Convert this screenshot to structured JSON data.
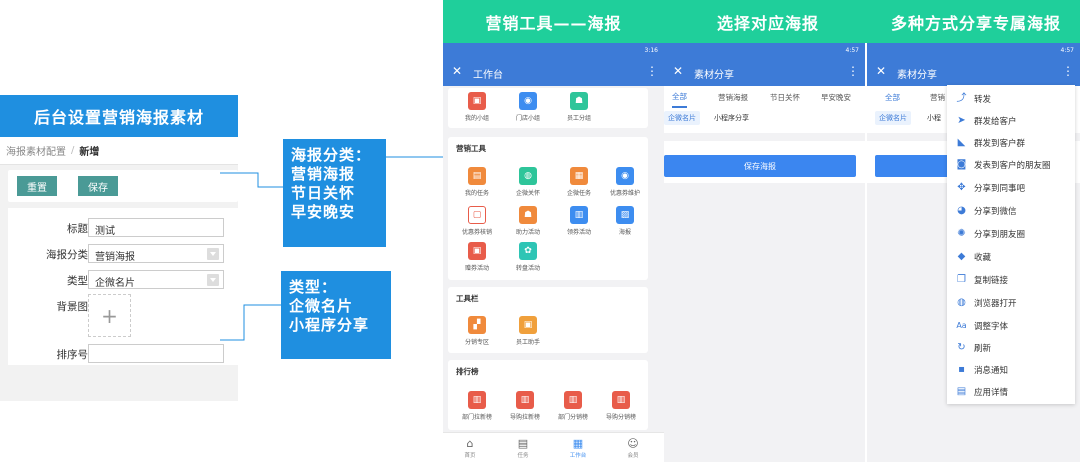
{
  "admin": {
    "title": "后台设置营销海报素材",
    "breadcrumb": {
      "parent": "海报素材配置",
      "separator": "/",
      "current": "新增"
    },
    "buttons": {
      "reset": "重置",
      "save": "保存"
    },
    "form": {
      "title_label": "标题",
      "title_value": "测试",
      "category_label": "海报分类",
      "category_value": "营销海报",
      "type_label": "类型",
      "type_value": "企微名片",
      "bg_label": "背景图",
      "upload_glyph": "+",
      "order_label": "排序号",
      "order_value": ""
    }
  },
  "callouts": {
    "category": [
      "海报分类：",
      "营销海报",
      "节日关怀",
      "早安晚安"
    ],
    "type": [
      "类型：",
      "企微名片",
      "小程序分享"
    ]
  },
  "headers": [
    "营销工具——海报",
    "选择对应海报",
    "多种方式分享专属海报"
  ],
  "phone1": {
    "status": "3:16",
    "title": "工作台",
    "close_glyph": "✕",
    "more_glyph": "⋮",
    "top_row": [
      {
        "label": "我的小组",
        "icon": "briefcase-icon",
        "glyph": "▣",
        "color": "#e85c4a"
      },
      {
        "label": "门店小组",
        "icon": "camera-icon",
        "glyph": "◉",
        "color": "#3d8df0"
      },
      {
        "label": "员工分组",
        "icon": "users-icon",
        "glyph": "☗",
        "color": "#2ec59a"
      }
    ],
    "sections": [
      {
        "title": "营销工具",
        "items": [
          {
            "label": "我的任务",
            "icon": "task-icon",
            "glyph": "▤",
            "color": "#f08a3c"
          },
          {
            "label": "企微关怀",
            "icon": "chat-icon",
            "glyph": "◍",
            "color": "#2ec59a"
          },
          {
            "label": "企微任务",
            "icon": "clipboard-icon",
            "glyph": "▦",
            "color": "#f08a3c"
          },
          {
            "label": "优惠券维护",
            "icon": "camera-icon",
            "glyph": "◉",
            "color": "#3d8df0"
          },
          {
            "label": "优惠券核销",
            "icon": "scan-icon",
            "glyph": "▢",
            "color": "#e85c4a"
          },
          {
            "label": "助力活动",
            "icon": "users-icon",
            "glyph": "☗",
            "color": "#f08a3c"
          },
          {
            "label": "领券活动",
            "icon": "ticket-icon",
            "glyph": "▥",
            "color": "#3d8df0"
          },
          {
            "label": "海报",
            "icon": "image-icon",
            "glyph": "▨",
            "color": "#3d8df0"
          },
          {
            "label": "赠券活动",
            "icon": "gift-icon",
            "glyph": "▣",
            "color": "#e85c4a"
          },
          {
            "label": "转盘活动",
            "icon": "wheel-icon",
            "glyph": "✿",
            "color": "#2ec5b5"
          }
        ]
      },
      {
        "title": "工具栏",
        "items": [
          {
            "label": "分销专区",
            "icon": "org-icon",
            "glyph": "▞",
            "color": "#f08a3c"
          },
          {
            "label": "员工助手",
            "icon": "briefcase-icon",
            "glyph": "▣",
            "color": "#f0a03c"
          }
        ]
      },
      {
        "title": "排行榜",
        "items": [
          {
            "label": "部门拉新榜",
            "icon": "bar-chart-icon",
            "glyph": "▥",
            "color": "#e85c4a"
          },
          {
            "label": "导购拉新榜",
            "icon": "bar-chart-icon",
            "glyph": "▥",
            "color": "#e85c4a"
          },
          {
            "label": "部门分销榜",
            "icon": "bar-chart-icon",
            "glyph": "▥",
            "color": "#e85c4a"
          },
          {
            "label": "导购分销榜",
            "icon": "bar-chart-icon",
            "glyph": "▥",
            "color": "#e85c4a"
          }
        ]
      }
    ],
    "tabs": [
      {
        "label": "首页",
        "icon": "home-icon",
        "glyph": "⌂",
        "active": false
      },
      {
        "label": "任务",
        "icon": "list-icon",
        "glyph": "▤",
        "active": false
      },
      {
        "label": "工作台",
        "icon": "grid-icon",
        "glyph": "▦",
        "active": true
      },
      {
        "label": "会员",
        "icon": "member-icon",
        "glyph": "☺",
        "active": false
      }
    ]
  },
  "phone2": {
    "status": "4:57",
    "title": "素材分享",
    "close_glyph": "✕",
    "more_glyph": "⋮",
    "segments": [
      "全部",
      "营销海报",
      "节日关怀",
      "早安晚安"
    ],
    "chips": [
      "企微名片",
      "小程序分享"
    ],
    "save": "保存海报"
  },
  "phone3": {
    "status": "4:57",
    "title": "素材分享",
    "close_glyph": "✕",
    "more_glyph": "⋮",
    "segments": [
      "全部",
      "营销"
    ],
    "chips": [
      "企微名片",
      "小程"
    ],
    "menu": [
      {
        "label": "转发",
        "icon": "forward-icon",
        "glyph": "⤴"
      },
      {
        "label": "群发给客户",
        "icon": "send-icon",
        "glyph": "➤"
      },
      {
        "label": "群发到客户群",
        "icon": "rss-icon",
        "glyph": "◣"
      },
      {
        "label": "发表到客户的朋友圈",
        "icon": "camera-icon",
        "glyph": "◙"
      },
      {
        "label": "分享到同事吧",
        "icon": "share-node-icon",
        "glyph": "✥"
      },
      {
        "label": "分享到微信",
        "icon": "wechat-icon",
        "glyph": "◕"
      },
      {
        "label": "分享到朋友圈",
        "icon": "moments-icon",
        "glyph": "✺"
      },
      {
        "label": "收藏",
        "icon": "cube-icon",
        "glyph": "◆"
      },
      {
        "label": "复制链接",
        "icon": "copy-icon",
        "glyph": "❐"
      },
      {
        "label": "浏览器打开",
        "icon": "globe-icon",
        "glyph": "◍"
      },
      {
        "label": "调整字体",
        "icon": "font-icon",
        "glyph": "Aa"
      },
      {
        "label": "刷新",
        "icon": "refresh-icon",
        "glyph": "↻"
      },
      {
        "label": "消息通知",
        "icon": "notify-icon",
        "glyph": "▪"
      },
      {
        "label": "应用详情",
        "icon": "app-detail-icon",
        "glyph": "▤"
      }
    ]
  },
  "colors": {
    "primary": "#1f8fe0",
    "green": "#1fcf9b",
    "appbar": "#3d7bd7",
    "teal_button": "#4a9a96"
  }
}
